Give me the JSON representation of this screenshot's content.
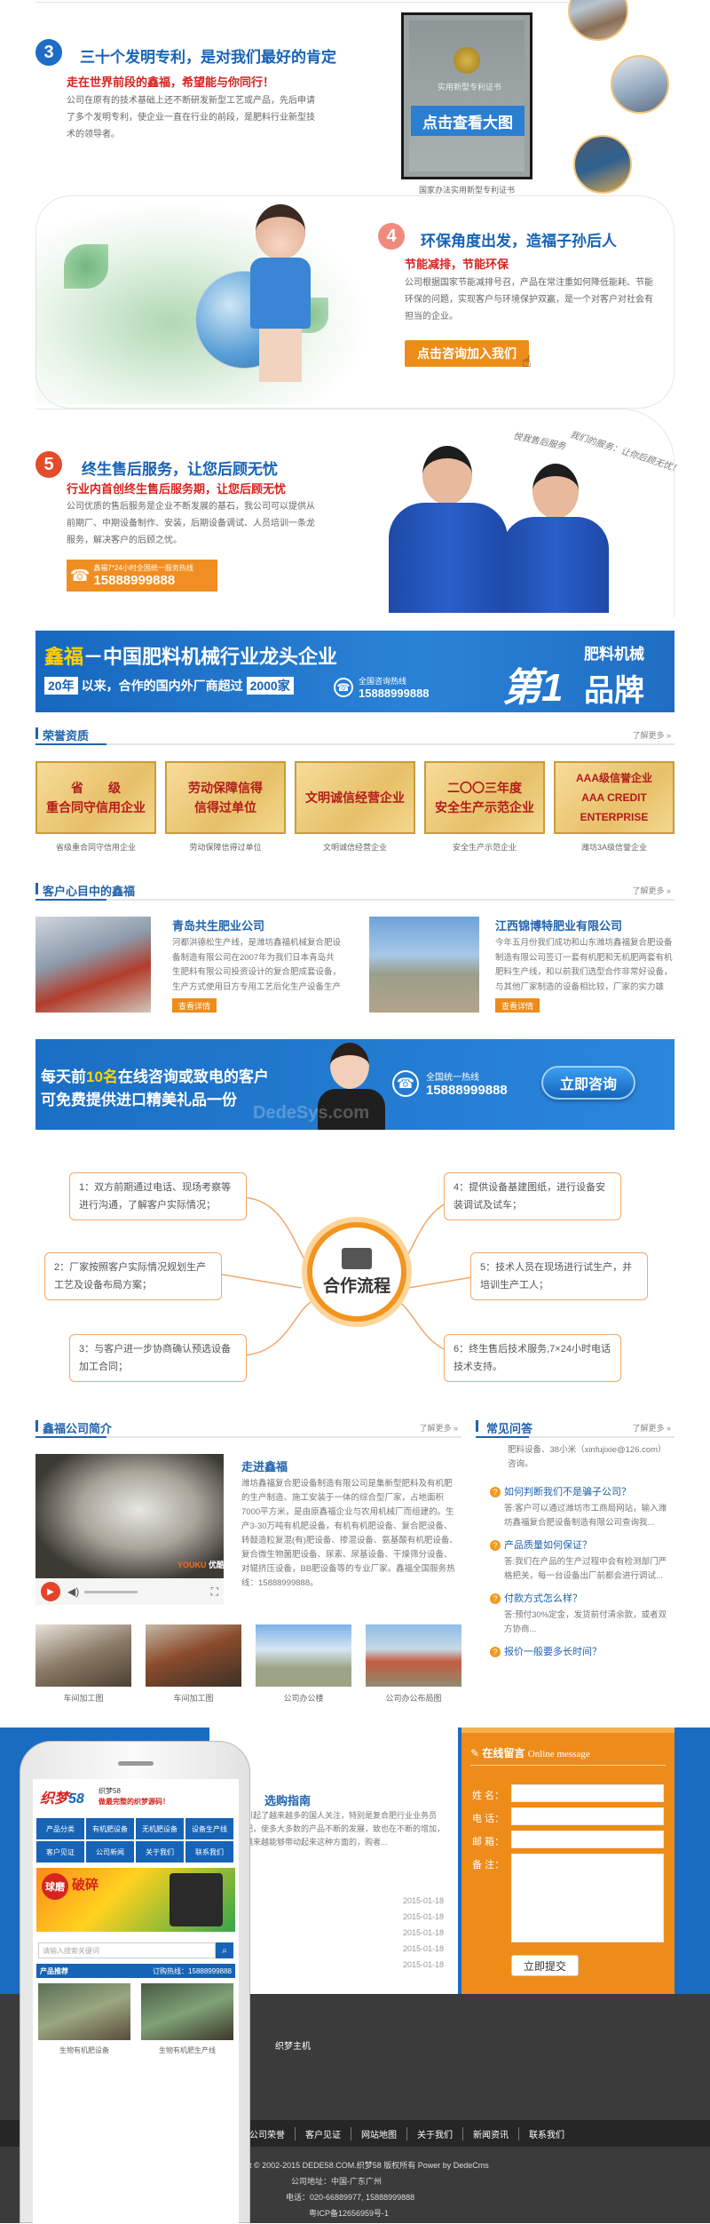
{
  "patent": {
    "number": "3",
    "title": "三十个发明专利，是对我们最好的肯定",
    "subtitle": "走在世界前段的鑫福，希望能与你同行！",
    "text": "公司在原有的技术基础上还不断研发新型工艺或产品，先后申请了多个发明专利，使企业一直在行业的前段，是肥料行业新型技术的领导者。",
    "cert_button": "点击查看大图",
    "cert_caption": "国家办法实用新型专利证书",
    "cert_title": "实用新型专利证书"
  },
  "eco": {
    "number": "4",
    "title": "环保角度出发，造福子孙后人",
    "subtitle": "节能减排，节能环保",
    "text": "公司根据国家节能减排号召，产品在常注重如何降低能耗、节能环保的问题，实现客户与环境保护双赢，是一个对客户对社会有担当的企业。",
    "button": "点击咨询加入我们"
  },
  "service": {
    "number": "5",
    "title": "终生售后服务，让您后顾无忧",
    "subtitle": "行业内首创终生售后服务期，让您后顾无忧",
    "text": "公司优质的售后服务是企业不断发展的基石，我公司可以提供从前期厂、中期设备制作、安装，后期设备调试、人员培训一条龙服务，解决客户的后顾之忧。",
    "hotline_label": "鑫福7*24小时全国统一服务热线",
    "hotline": "15888999888",
    "slogan": "我们的服务：让你后顾无忧！",
    "slogan_left": "悦我售后服务"
  },
  "banner1": {
    "brand": "鑫福",
    "title": "－中国肥料机械行业龙头企业",
    "years_prefix": "20年",
    "years_text": "以来，合作的国内外厂商超过",
    "count": "2000家",
    "hotline_label": "全国咨询热线",
    "hotline": "15888999888",
    "big_num": "第1",
    "brand_top": "肥料机械",
    "brand_bottom": "品牌"
  },
  "honors": {
    "title": "荣誉资质",
    "more": "了解更多 »",
    "items": [
      {
        "name": "省级重合同守信用企业",
        "text": "省　　级\n重合同守信用企业"
      },
      {
        "name": "劳动保障信得过单位",
        "text": "劳动保障信得\n信得过单位"
      },
      {
        "name": "文明诚信经营企业",
        "text": "文明诚信经营企业"
      },
      {
        "name": "安全生产示范企业",
        "text": "二〇〇三年度\n安全生产示范企业"
      },
      {
        "name": "潍坊3A级信誉企业",
        "text": "AAA级信誉企业\nAAA CREDIT ENTERPRISE"
      }
    ]
  },
  "customers": {
    "title": "客户心目中的鑫福",
    "more": "了解更多 »",
    "items": [
      {
        "name": "青岛共生肥业公司",
        "text": "河都洪德松生产线，是潍坊鑫福机械复合肥设备制造有限公司在2007年为我们日本青岛共生肥料有限公司投资设计的复合肥成套设备，生产方式使用日方专用工艺后化生产设备生产线，生产线总额二...",
        "button": "查看详情"
      },
      {
        "name": "江西锦博特肥业有限公司",
        "text": "今年五月份我们成功和山东潍坊鑫福复合肥设备制造有限公司签订一套有机肥和无机肥两套有机肥料生产线，和以前我们选型合作非常好设备，与其他厂家制造的设备相比较，厂家的实力雄厚，技术过硬，设备售后...",
        "button": "查看详情"
      }
    ]
  },
  "cta": {
    "line1_a": "每天前",
    "line1_num": "10名",
    "line1_b": "在线咨询或致电的客户",
    "line2": "可免费提供进口精美礼品一份",
    "hotline_label": "全国统一热线",
    "hotline": "15888999888",
    "button": "立即咨询",
    "watermark": "DedeSys.com"
  },
  "process": {
    "center": "合作流程",
    "steps": [
      "1：双方前期通过电话、现场考察等进行沟通，了解客户实际情况；",
      "2：厂家按照客户实际情况规划生产工艺及设备布局方案；",
      "3：与客户进一步协商确认预选设备加工合同；",
      "4：提供设备基建图纸，进行设备安装调试及试车；",
      "5：技术人员在现场进行试生产，并培训生产工人；",
      "6：终生售后技术服务,7×24小时电话技术支持。"
    ]
  },
  "company": {
    "title": "鑫福公司简介",
    "more": "了解更多 »",
    "heading": "走进鑫福",
    "text": "潍坊鑫福复合肥设备制造有限公司是集新型肥料及有机肥的生产制造、施工安装于一体的综合型厂家，占地面积7000平方米，是由原鑫福企业与农用机械厂而组建的。生产3-30万吨有机肥设备，有机有机肥设备、复合肥设备、转鼓造粒复混(有)肥设备、掺混设备、氨基酸有机肥设备、复合微生物菌肥设备、尿素、尿基设备、干燥筛分设备、对辊挤压设备，BB肥设备等的专业厂家。鑫福全国服务热线：15888999888。",
    "photos": [
      {
        "cap": "车间加工图"
      },
      {
        "cap": "车间加工图"
      },
      {
        "cap": "公司办公楼"
      },
      {
        "cap": "公司办公布局图"
      }
    ],
    "video_logo": "YOUKU",
    "video_brand": "优酷"
  },
  "faq": {
    "title": "常见问答",
    "more": "了解更多 »",
    "top_text": "肥料设备、38小米（xinfujixie@126.com）咨询。",
    "items": [
      {
        "q": "如何判断我们不是骗子公司？",
        "a": "答:客户可以通过潍坊市工商局网站，输入潍坊鑫福复合肥设备制造有限公司查询我..."
      },
      {
        "q": "产品质量如何保证？",
        "a": "答:我们在产品的生产过程中会有检测部门严格把关，每一台设备出厂前都会进行调试..."
      },
      {
        "q": "付款方式怎么样？",
        "a": "答:预付30%定金，发货前付清余款，或者双方协商..."
      },
      {
        "q": "报价一般要多长时间？",
        "a": ""
      }
    ]
  },
  "news": {
    "heading": "选购指南",
    "text": "引起了越来越多的国人关注，特别是复合肥行业业务员把，使多大多数的产品不断的发展，致也在不断的增加，越来越能够带动起来这种方面的，购者...",
    "dates": [
      "2015-01-18",
      "2015-01-18",
      "2015-01-18",
      "2015-01-18",
      "2015-01-18"
    ]
  },
  "message": {
    "title": "在线留言",
    "title_en": "Online message",
    "fields": [
      "姓 名：",
      "电 话：",
      "邮 箱：",
      "备 注："
    ],
    "submit": "立即提交"
  },
  "footer": {
    "brand": "织梦主机",
    "links": [
      "公司荣誉",
      "客户见证",
      "网站地图",
      "关于我们",
      "新闻资讯",
      "联系我们"
    ],
    "copyright": "ht © 2002-2015 DEDE58.COM.织梦58 版权所有 Power by DedeCms",
    "address": "公司地址：中国-广东广州",
    "phone": "电话：020-66889977, 15888999888",
    "icp": "粤ICP备12656959号-1"
  },
  "phone": {
    "logo_left": "织梦",
    "logo_num": "58",
    "tag1": "织梦58",
    "tag2": "做最完整的织梦源码！",
    "nav": [
      "产品分类",
      "有机肥设备",
      "无机肥设备",
      "设备生产线",
      "客户见证",
      "公司新闻",
      "关于我们",
      "联系我们"
    ],
    "promo_a": "球磨",
    "promo_b": "破碎",
    "search_placeholder": "请输入搜索关键词",
    "products_label": "产品推荐",
    "products_phone": "订购热线：15888999888",
    "products": [
      "生物有机肥设备",
      "生物有机肥生产线"
    ]
  },
  "colors": {
    "blue": "#1763b6",
    "orange": "#ee8c1a",
    "red": "#d8231f"
  }
}
